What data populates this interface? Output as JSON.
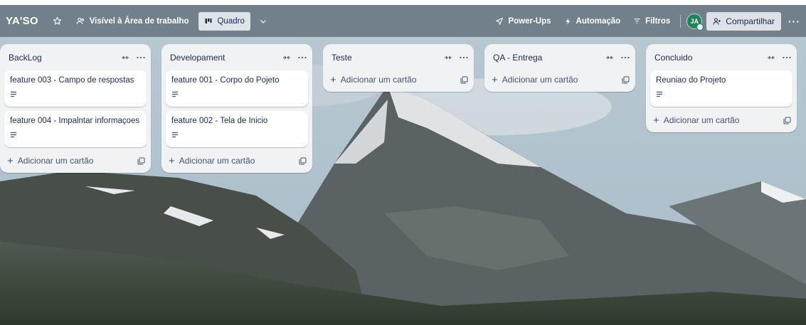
{
  "header": {
    "title": "YA'SO",
    "visibility_label": "Visível à Área de trabalho",
    "view_label": "Quadro",
    "powerups_label": "Power-Ups",
    "automation_label": "Automação",
    "filters_label": "Filtros",
    "avatar_initials": "JA",
    "share_label": "Compartilhar",
    "more_label": "···"
  },
  "lists": [
    {
      "title": "BackLog",
      "cards": [
        {
          "title": "feature 003 - Campo de respostas"
        },
        {
          "title": "feature 004 - Impalntar informaçoes"
        }
      ],
      "add_label": "Adicionar um cartão"
    },
    {
      "title": "Developament",
      "cards": [
        {
          "title": "feature 001 - Corpo do Pojeto"
        },
        {
          "title": "feature 002 - Tela de Inicio"
        }
      ],
      "add_label": "Adicionar um cartão"
    },
    {
      "title": "Teste",
      "cards": [],
      "add_label": "Adicionar um cartão"
    },
    {
      "title": "QA - Entrega",
      "cards": [],
      "add_label": "Adicionar um cartão"
    },
    {
      "title": "Concluido",
      "cards": [
        {
          "title": "Reuniao do Projeto"
        }
      ],
      "add_label": "Adicionar um cartão"
    }
  ],
  "icons": {
    "star": "star-icon",
    "visibility": "workspace-visibility-icon",
    "view": "board-view-icon",
    "chevron": "chevron-down-icon",
    "powerups": "rocket-icon",
    "automation": "lightning-icon",
    "filter": "filter-icon",
    "share": "add-member-icon",
    "collapse": "collapse-list-icon",
    "menu": "more-dots-icon",
    "description": "description-icon",
    "add": "plus-icon",
    "template": "card-template-icon"
  },
  "colors": {
    "header_overlay": "#46545e",
    "list_bg": "#f1f2f4",
    "card_bg": "#ffffff",
    "avatar_bg": "#1f845a",
    "text": "#172b4d"
  }
}
